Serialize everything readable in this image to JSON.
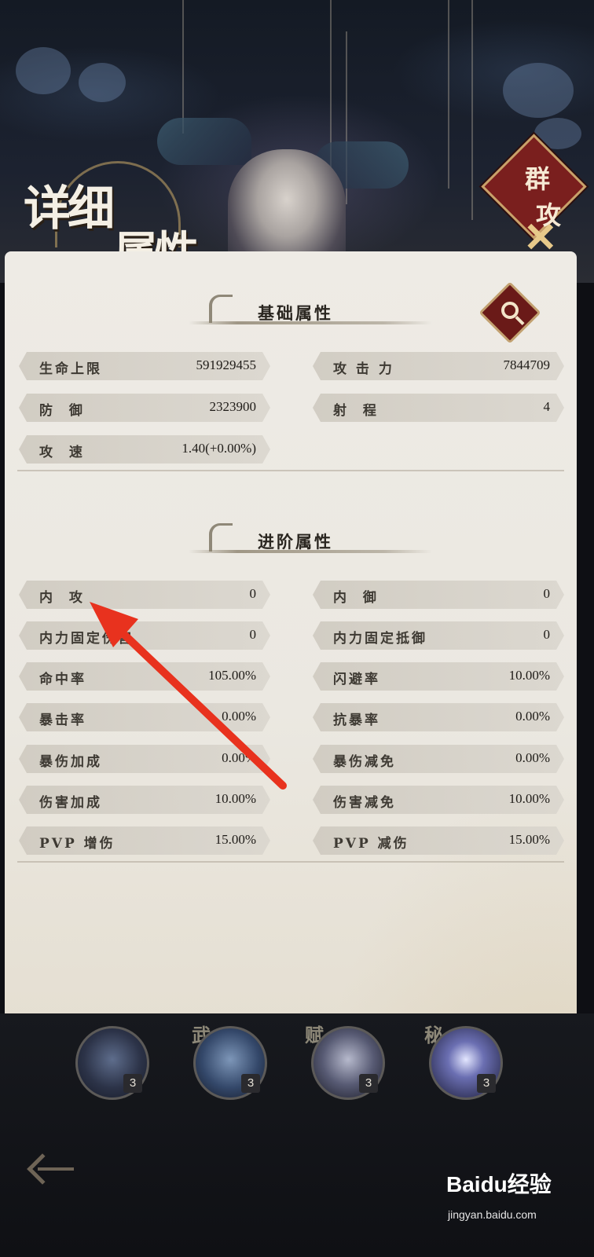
{
  "header": {
    "title_line1": "详细",
    "title_line2": "属性",
    "badge_line1": "群",
    "badge_line2": "攻",
    "badge_icon": "crossed-swords-icon"
  },
  "basic": {
    "heading": "基础属性",
    "search_icon": "magnifier-icon",
    "stats": [
      {
        "label": "生命上限",
        "value": "591929455"
      },
      {
        "label": "攻 击 力",
        "value": "7844709"
      },
      {
        "label": "防  御",
        "value": "2323900"
      },
      {
        "label": "射  程",
        "value": "4"
      },
      {
        "label": "攻  速",
        "value": "1.40(+0.00%)"
      }
    ]
  },
  "advanced": {
    "heading": "进阶属性",
    "stats": [
      {
        "label": "内  攻",
        "value": "0"
      },
      {
        "label": "内  御",
        "value": "0"
      },
      {
        "label": "内力固定伤害",
        "value": "0"
      },
      {
        "label": "内力固定抵御",
        "value": "0"
      },
      {
        "label": "命中率",
        "value": "105.00%"
      },
      {
        "label": "闪避率",
        "value": "10.00%"
      },
      {
        "label": "暴击率",
        "value": "0.00%"
      },
      {
        "label": "抗暴率",
        "value": "0.00%"
      },
      {
        "label": "暴伤加成",
        "value": "0.00%"
      },
      {
        "label": "暴伤减免",
        "value": "0.00%"
      },
      {
        "label": "伤害加成",
        "value": "10.00%"
      },
      {
        "label": "伤害减免",
        "value": "10.00%"
      },
      {
        "label": "PVP 增伤",
        "value": "15.00%"
      },
      {
        "label": "PVP 减伤",
        "value": "15.00%"
      }
    ]
  },
  "skills": [
    {
      "tag": "",
      "level": "3"
    },
    {
      "tag": "武",
      "level": "3"
    },
    {
      "tag": "赋",
      "level": "3"
    },
    {
      "tag": "秘",
      "level": "3"
    }
  ],
  "footer": {
    "back_icon": "back-arrow-icon",
    "watermark": "Baidu经验",
    "watermark_sub": "jingyan.baidu.com"
  },
  "colors": {
    "accent_red": "#7a1f1e",
    "gold": "#c8a16a",
    "annotation_arrow": "#e8321e"
  }
}
